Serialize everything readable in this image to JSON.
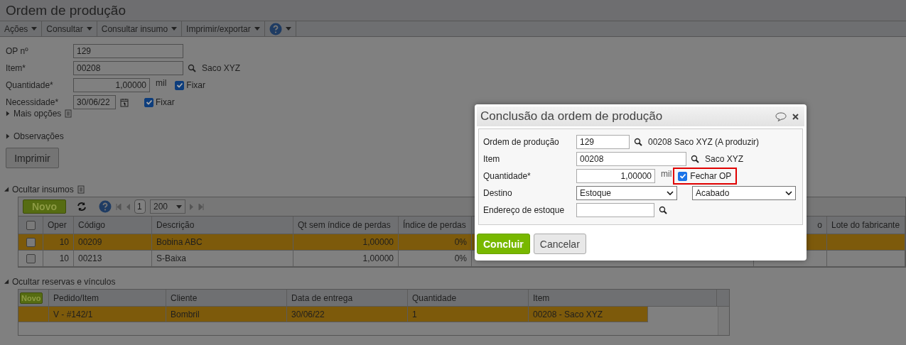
{
  "page": {
    "title": "Ordem de produção"
  },
  "menu": [
    {
      "label": "Ações"
    },
    {
      "label": "Consultar"
    },
    {
      "label": "Consultar insumo"
    },
    {
      "label": "Imprimir/exportar"
    }
  ],
  "form": {
    "op": {
      "label": "OP nº",
      "value": "129"
    },
    "item": {
      "label": "Item*",
      "value": "00208",
      "description": "Saco XYZ"
    },
    "quantity": {
      "label": "Quantidade*",
      "value": "1,00000",
      "unit": "mil",
      "fix_label": "Fixar",
      "fix_checked": true
    },
    "need": {
      "label": "Necessidade*",
      "value": "30/06/22",
      "fix_label": "Fixar",
      "fix_checked": true
    }
  },
  "sections": [
    {
      "label": "Mais opções",
      "expanded": false,
      "notes": true
    },
    {
      "label": "Observações",
      "expanded": false,
      "notes": false
    }
  ],
  "print_button": "Imprimir",
  "insumos": {
    "title": "Ocultar insumos",
    "expanded": true,
    "new_button": "Novo",
    "page": "1",
    "page_size": "200",
    "all_checked": false,
    "columns": [
      "Oper",
      "Código",
      "Descrição",
      "Qt sem índice de perdas",
      "Índice de perdas",
      "o",
      "Lote do fabricante"
    ],
    "rows": [
      {
        "selected": true,
        "checked": false,
        "cells": [
          "10",
          "00209",
          "Bobina ABC",
          "1,00000",
          "0%"
        ]
      },
      {
        "selected": false,
        "checked": false,
        "cells": [
          "10",
          "00213",
          "S-Baixa",
          "1,00000",
          "0%"
        ]
      }
    ]
  },
  "reservas": {
    "title": "Ocultar reservas e vínculos",
    "expanded": true,
    "new_button": "Novo",
    "columns": [
      "Pedido/Item",
      "Cliente",
      "Data de entrega",
      "Quantidade",
      "Item"
    ],
    "rows": [
      {
        "selected": true,
        "cells": [
          "V - #142/1",
          "Bombril",
          "30/06/22",
          "1",
          "00208 - Saco XYZ"
        ]
      }
    ]
  },
  "dialog": {
    "title": "Conclusão da ordem de produção",
    "order": {
      "label": "Ordem de produção",
      "value": "129",
      "description": "00208 Saco XYZ (A produzir)"
    },
    "item": {
      "label": "Item",
      "value": "00208",
      "description": "Saco XYZ"
    },
    "quantity": {
      "label": "Quantidade*",
      "value": "1,00000",
      "unit": "mil"
    },
    "close_op": {
      "label": "Fechar OP",
      "checked": true,
      "highlighted": true
    },
    "destination": {
      "label": "Destino",
      "value": "Estoque",
      "value_2": "Acabado"
    },
    "address": {
      "label": "Endereço de estoque"
    },
    "buttons": [
      {
        "label": "Concluir",
        "kind": "primary"
      },
      {
        "label": "Cancelar",
        "kind": "secondary"
      }
    ]
  }
}
